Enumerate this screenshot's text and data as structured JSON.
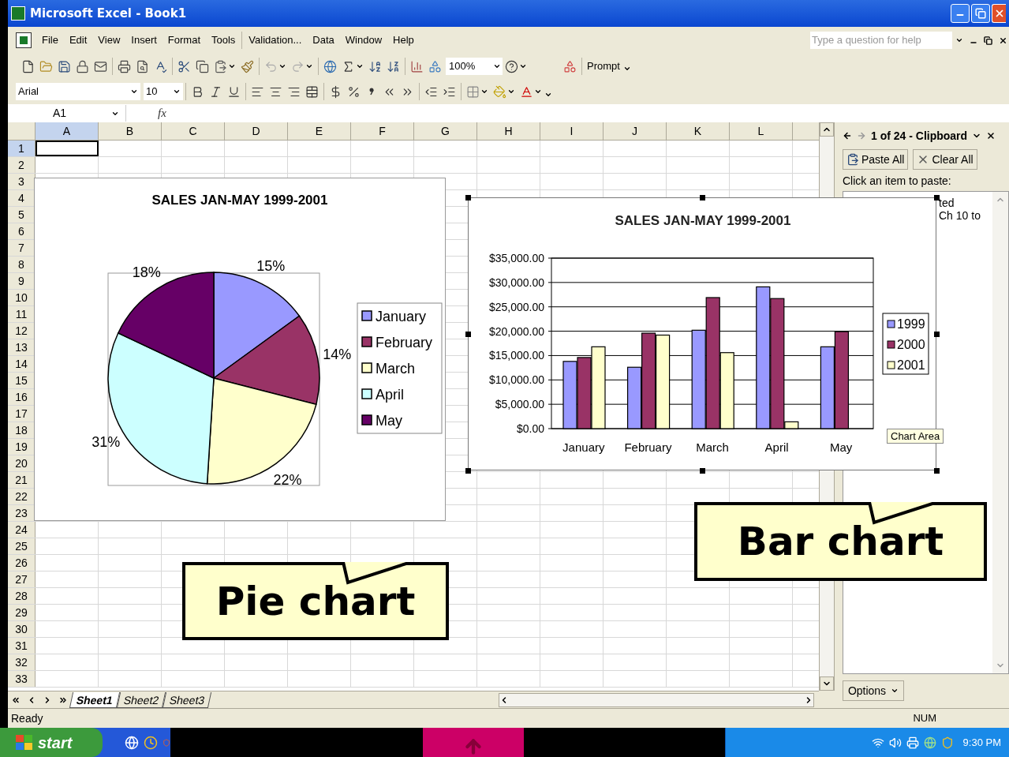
{
  "window": {
    "title": "Microsoft Excel - Book1"
  },
  "menu": [
    "File",
    "Edit",
    "View",
    "Insert",
    "Format",
    "Tools",
    "Validation...",
    "Data",
    "Window",
    "Help"
  ],
  "help_box": {
    "placeholder": "Type a question for help"
  },
  "standard_toolbar": {
    "zoom": "100%",
    "prompt": "Prompt"
  },
  "format_toolbar": {
    "font": "Arial",
    "size": "10"
  },
  "formula_bar": {
    "name_box": "A1",
    "function_label": "fx"
  },
  "sheet": {
    "columns": [
      {
        "label": "A",
        "selected": true
      },
      {
        "label": "B",
        "selected": false
      },
      {
        "label": "C",
        "selected": false
      },
      {
        "label": "D",
        "selected": false
      },
      {
        "label": "E",
        "selected": false
      },
      {
        "label": "F",
        "selected": false
      },
      {
        "label": "G",
        "selected": false
      },
      {
        "label": "H",
        "selected": false
      },
      {
        "label": "I",
        "selected": false
      },
      {
        "label": "J",
        "selected": false
      },
      {
        "label": "K",
        "selected": false
      },
      {
        "label": "L",
        "selected": false
      }
    ],
    "rows": [
      {
        "label": "1",
        "selected": true
      },
      {
        "label": "2",
        "selected": false
      },
      {
        "label": "3",
        "selected": false
      },
      {
        "label": "4",
        "selected": false
      },
      {
        "label": "5",
        "selected": false
      },
      {
        "label": "6",
        "selected": false
      },
      {
        "label": "7",
        "selected": false
      },
      {
        "label": "8",
        "selected": false
      },
      {
        "label": "9",
        "selected": false
      },
      {
        "label": "10",
        "selected": false
      },
      {
        "label": "11",
        "selected": false
      },
      {
        "label": "12",
        "selected": false
      },
      {
        "label": "13",
        "selected": false
      },
      {
        "label": "14",
        "selected": false
      },
      {
        "label": "15",
        "selected": false
      },
      {
        "label": "16",
        "selected": false
      },
      {
        "label": "17",
        "selected": false
      },
      {
        "label": "18",
        "selected": false
      },
      {
        "label": "19",
        "selected": false
      },
      {
        "label": "20",
        "selected": false
      },
      {
        "label": "21",
        "selected": false
      },
      {
        "label": "22",
        "selected": false
      },
      {
        "label": "23",
        "selected": false
      },
      {
        "label": "24",
        "selected": false
      },
      {
        "label": "25",
        "selected": false
      },
      {
        "label": "26",
        "selected": false
      },
      {
        "label": "27",
        "selected": false
      },
      {
        "label": "28",
        "selected": false
      },
      {
        "label": "29",
        "selected": false
      },
      {
        "label": "30",
        "selected": false
      },
      {
        "label": "31",
        "selected": false
      },
      {
        "label": "32",
        "selected": false
      },
      {
        "label": "33",
        "selected": false
      }
    ]
  },
  "pie_chart": {
    "selected": false,
    "chart_data": {
      "type": "pie",
      "title": "SALES JAN-MAY 1999-2001",
      "categories": [
        "January",
        "February",
        "March",
        "April",
        "May"
      ],
      "values": [
        15,
        14,
        22,
        31,
        18
      ],
      "colors": [
        "#9999ff",
        "#993366",
        "#ffffcc",
        "#ccffff",
        "#660066"
      ],
      "legend": "right",
      "value_labels": [
        "15%",
        "14%",
        "22%",
        "31%",
        "18%"
      ]
    }
  },
  "bar_chart": {
    "selected": true,
    "chart_data": {
      "type": "bar",
      "title": "SALES JAN-MAY 1999-2001",
      "categories": [
        "January",
        "February",
        "March",
        "April",
        "May"
      ],
      "series": [
        {
          "name": "1999",
          "color": "#9999ff",
          "values": [
            13800,
            12600,
            20200,
            29100,
            16800
          ]
        },
        {
          "name": "2000",
          "color": "#993366",
          "values": [
            14600,
            19600,
            26900,
            26700,
            19900
          ]
        },
        {
          "name": "2001",
          "color": "#ffffcc",
          "values": [
            16800,
            19200,
            15600,
            1400,
            null
          ]
        }
      ],
      "ylim": [
        0,
        35000
      ],
      "legend": "right",
      "grid": true,
      "yticks": [
        {
          "value": 0,
          "label": "$0.00"
        },
        {
          "value": 5000,
          "label": "$5,000.00"
        },
        {
          "value": 10000,
          "label": "$10,000.00"
        },
        {
          "value": 15000,
          "label": "$15,000.00"
        },
        {
          "value": 20000,
          "label": "$20,000.00"
        },
        {
          "value": 25000,
          "label": "$25,000.00"
        },
        {
          "value": 30000,
          "label": "$30,000.00"
        },
        {
          "value": 35000,
          "label": "$35,000.00"
        }
      ]
    }
  },
  "tooltip": "Chart Area",
  "callouts": [
    {
      "text": "Pie chart"
    },
    {
      "text": "Bar chart"
    }
  ],
  "task_pane": {
    "title": "1 of 24 - Clipboard",
    "buttons": [
      "Paste All",
      "Clear All"
    ],
    "instruction": "Click an item to paste:",
    "items": [
      "ted",
      "Ch 10 to"
    ],
    "options": "Options"
  },
  "sheet_tabs": [
    {
      "label": "Sheet1",
      "selected": true
    },
    {
      "label": "Sheet2",
      "selected": false
    },
    {
      "label": "Sheet3",
      "selected": false
    }
  ],
  "status_bar": {
    "status": "Ready",
    "num": "NUM"
  },
  "taskbar": {
    "start": "start",
    "clock": "9:30 PM"
  }
}
